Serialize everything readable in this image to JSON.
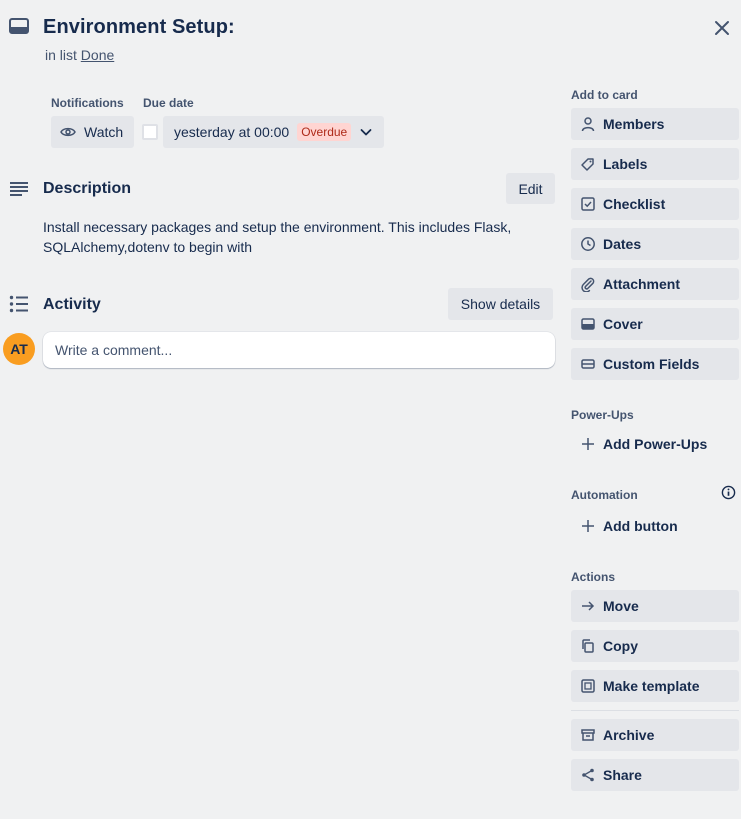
{
  "card": {
    "title": "Environment Setup:",
    "in_list_prefix": "in list",
    "list_name": "Done"
  },
  "notifications": {
    "label": "Notifications",
    "watch_label": "Watch"
  },
  "due_date": {
    "label": "Due date",
    "value": "yesterday at 00:00",
    "status": "Overdue"
  },
  "description": {
    "title": "Description",
    "edit_label": "Edit",
    "text": "Install necessary packages and setup the environment. This includes Flask, SQLAlchemy,dotenv to begin with"
  },
  "activity": {
    "title": "Activity",
    "show_details_label": "Show details",
    "avatar_initials": "AT",
    "comment_placeholder": "Write a comment..."
  },
  "sidebar": {
    "add_to_card_label": "Add to card",
    "add_to_card": [
      {
        "label": "Members",
        "icon": "person-icon"
      },
      {
        "label": "Labels",
        "icon": "tag-icon"
      },
      {
        "label": "Checklist",
        "icon": "checklist-icon"
      },
      {
        "label": "Dates",
        "icon": "clock-icon"
      },
      {
        "label": "Attachment",
        "icon": "paperclip-icon"
      },
      {
        "label": "Cover",
        "icon": "cover-icon"
      },
      {
        "label": "Custom Fields",
        "icon": "custom-fields-icon"
      }
    ],
    "power_ups_label": "Power-Ups",
    "add_power_ups": "Add Power-Ups",
    "automation_label": "Automation",
    "add_button": "Add button",
    "actions_label": "Actions",
    "actions": [
      {
        "label": "Move",
        "icon": "arrow-right-icon"
      },
      {
        "label": "Copy",
        "icon": "copy-icon"
      },
      {
        "label": "Make template",
        "icon": "template-icon"
      },
      {
        "label": "Archive",
        "icon": "archive-icon"
      },
      {
        "label": "Share",
        "icon": "share-icon"
      }
    ]
  },
  "colors": {
    "background": "#f0f1f2",
    "button": "#e4e6ea",
    "overdue_bg": "#ffd5d2",
    "overdue_text": "#ae2a19",
    "avatar": "#f99d20"
  }
}
